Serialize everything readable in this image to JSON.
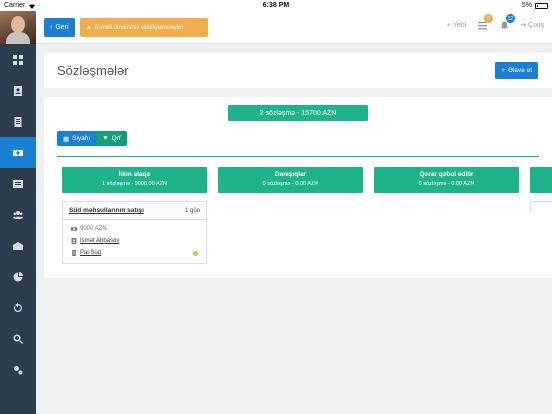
{
  "status_bar": {
    "carrier": "Carrier",
    "time": "6:38 PM",
    "battery": "5%"
  },
  "sidebar": {
    "items": [
      {
        "icon": "dashboard-icon",
        "active": false
      },
      {
        "icon": "contacts-icon",
        "active": false
      },
      {
        "icon": "document-icon",
        "active": false
      },
      {
        "icon": "money-icon",
        "active": true
      },
      {
        "icon": "list-icon",
        "active": false
      },
      {
        "icon": "users-icon",
        "active": false
      },
      {
        "icon": "mail-icon",
        "active": false
      },
      {
        "icon": "chart-pie-icon",
        "active": false
      },
      {
        "icon": "history-icon",
        "active": false
      },
      {
        "icon": "search-icon",
        "active": false
      },
      {
        "icon": "settings-icon",
        "active": false
      }
    ]
  },
  "topbar": {
    "back_label": "Geri",
    "warning_label": "E-mail ünvanınız təsdiqlənməyib!",
    "new_label": "Yeni",
    "tasks_count": "0",
    "notifications_count": "12",
    "logout_label": "Çıxış"
  },
  "page": {
    "title": "Sözləşmələr",
    "add_label": "Əlavə et"
  },
  "summary": "2 sözləşmə - 15700 AZN",
  "view_toggle": {
    "list_label": "Siyahı",
    "filter_label": "Qrf"
  },
  "stages": [
    {
      "name": "İlkin əlaqə",
      "subtitle": "1 sözləşmə - 9000.00 AZN",
      "deals": [
        {
          "title": "Süd məhsullarının satışı",
          "days": "1 gün",
          "amount": "9000 AZN",
          "contact": "İsmət Abbasov",
          "company": "Pal Süd"
        }
      ]
    },
    {
      "name": "Danışıqlar",
      "subtitle": "0 sözləşmə - 0.00 AZN",
      "deals": []
    },
    {
      "name": "Qərar qəbul edilir",
      "subtitle": "0 sözləşmə - 0.00 AZN",
      "deals": []
    }
  ],
  "colors": {
    "primary": "#1a7fd1",
    "success": "#1fb38a",
    "warning": "#f0ad4e",
    "sidebar": "#2d3d4d"
  }
}
